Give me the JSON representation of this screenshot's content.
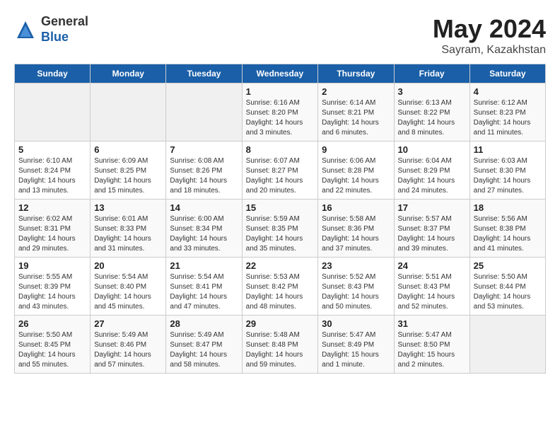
{
  "header": {
    "logo_general": "General",
    "logo_blue": "Blue",
    "title": "May 2024",
    "subtitle": "Sayram, Kazakhstan"
  },
  "days_of_week": [
    "Sunday",
    "Monday",
    "Tuesday",
    "Wednesday",
    "Thursday",
    "Friday",
    "Saturday"
  ],
  "weeks": [
    [
      {
        "day": "",
        "info": ""
      },
      {
        "day": "",
        "info": ""
      },
      {
        "day": "",
        "info": ""
      },
      {
        "day": "1",
        "info": "Sunrise: 6:16 AM\nSunset: 8:20 PM\nDaylight: 14 hours\nand 3 minutes."
      },
      {
        "day": "2",
        "info": "Sunrise: 6:14 AM\nSunset: 8:21 PM\nDaylight: 14 hours\nand 6 minutes."
      },
      {
        "day": "3",
        "info": "Sunrise: 6:13 AM\nSunset: 8:22 PM\nDaylight: 14 hours\nand 8 minutes."
      },
      {
        "day": "4",
        "info": "Sunrise: 6:12 AM\nSunset: 8:23 PM\nDaylight: 14 hours\nand 11 minutes."
      }
    ],
    [
      {
        "day": "5",
        "info": "Sunrise: 6:10 AM\nSunset: 8:24 PM\nDaylight: 14 hours\nand 13 minutes."
      },
      {
        "day": "6",
        "info": "Sunrise: 6:09 AM\nSunset: 8:25 PM\nDaylight: 14 hours\nand 15 minutes."
      },
      {
        "day": "7",
        "info": "Sunrise: 6:08 AM\nSunset: 8:26 PM\nDaylight: 14 hours\nand 18 minutes."
      },
      {
        "day": "8",
        "info": "Sunrise: 6:07 AM\nSunset: 8:27 PM\nDaylight: 14 hours\nand 20 minutes."
      },
      {
        "day": "9",
        "info": "Sunrise: 6:06 AM\nSunset: 8:28 PM\nDaylight: 14 hours\nand 22 minutes."
      },
      {
        "day": "10",
        "info": "Sunrise: 6:04 AM\nSunset: 8:29 PM\nDaylight: 14 hours\nand 24 minutes."
      },
      {
        "day": "11",
        "info": "Sunrise: 6:03 AM\nSunset: 8:30 PM\nDaylight: 14 hours\nand 27 minutes."
      }
    ],
    [
      {
        "day": "12",
        "info": "Sunrise: 6:02 AM\nSunset: 8:31 PM\nDaylight: 14 hours\nand 29 minutes."
      },
      {
        "day": "13",
        "info": "Sunrise: 6:01 AM\nSunset: 8:33 PM\nDaylight: 14 hours\nand 31 minutes."
      },
      {
        "day": "14",
        "info": "Sunrise: 6:00 AM\nSunset: 8:34 PM\nDaylight: 14 hours\nand 33 minutes."
      },
      {
        "day": "15",
        "info": "Sunrise: 5:59 AM\nSunset: 8:35 PM\nDaylight: 14 hours\nand 35 minutes."
      },
      {
        "day": "16",
        "info": "Sunrise: 5:58 AM\nSunset: 8:36 PM\nDaylight: 14 hours\nand 37 minutes."
      },
      {
        "day": "17",
        "info": "Sunrise: 5:57 AM\nSunset: 8:37 PM\nDaylight: 14 hours\nand 39 minutes."
      },
      {
        "day": "18",
        "info": "Sunrise: 5:56 AM\nSunset: 8:38 PM\nDaylight: 14 hours\nand 41 minutes."
      }
    ],
    [
      {
        "day": "19",
        "info": "Sunrise: 5:55 AM\nSunset: 8:39 PM\nDaylight: 14 hours\nand 43 minutes."
      },
      {
        "day": "20",
        "info": "Sunrise: 5:54 AM\nSunset: 8:40 PM\nDaylight: 14 hours\nand 45 minutes."
      },
      {
        "day": "21",
        "info": "Sunrise: 5:54 AM\nSunset: 8:41 PM\nDaylight: 14 hours\nand 47 minutes."
      },
      {
        "day": "22",
        "info": "Sunrise: 5:53 AM\nSunset: 8:42 PM\nDaylight: 14 hours\nand 48 minutes."
      },
      {
        "day": "23",
        "info": "Sunrise: 5:52 AM\nSunset: 8:43 PM\nDaylight: 14 hours\nand 50 minutes."
      },
      {
        "day": "24",
        "info": "Sunrise: 5:51 AM\nSunset: 8:43 PM\nDaylight: 14 hours\nand 52 minutes."
      },
      {
        "day": "25",
        "info": "Sunrise: 5:50 AM\nSunset: 8:44 PM\nDaylight: 14 hours\nand 53 minutes."
      }
    ],
    [
      {
        "day": "26",
        "info": "Sunrise: 5:50 AM\nSunset: 8:45 PM\nDaylight: 14 hours\nand 55 minutes."
      },
      {
        "day": "27",
        "info": "Sunrise: 5:49 AM\nSunset: 8:46 PM\nDaylight: 14 hours\nand 57 minutes."
      },
      {
        "day": "28",
        "info": "Sunrise: 5:49 AM\nSunset: 8:47 PM\nDaylight: 14 hours\nand 58 minutes."
      },
      {
        "day": "29",
        "info": "Sunrise: 5:48 AM\nSunset: 8:48 PM\nDaylight: 14 hours\nand 59 minutes."
      },
      {
        "day": "30",
        "info": "Sunrise: 5:47 AM\nSunset: 8:49 PM\nDaylight: 15 hours\nand 1 minute."
      },
      {
        "day": "31",
        "info": "Sunrise: 5:47 AM\nSunset: 8:50 PM\nDaylight: 15 hours\nand 2 minutes."
      },
      {
        "day": "",
        "info": ""
      }
    ]
  ]
}
